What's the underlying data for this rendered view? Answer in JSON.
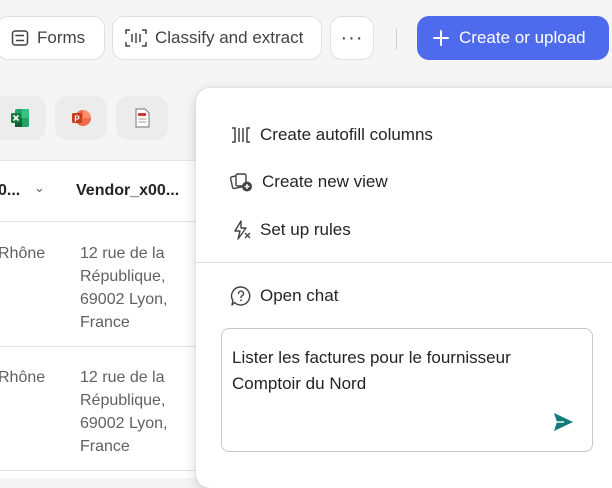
{
  "toolbar": {
    "forms_label": "Forms",
    "classify_label": "Classify and extract",
    "more_label": "···",
    "create_label": "Create or upload"
  },
  "file_chips": [
    {
      "icon": "excel-icon",
      "color": "#107c41"
    },
    {
      "icon": "powerpoint-icon",
      "color": "#c43e1c"
    },
    {
      "icon": "pdf-icon",
      "color": "#d13438"
    }
  ],
  "table": {
    "columns": [
      {
        "label": "0..."
      },
      {
        "label": "Vendor_x00..."
      }
    ],
    "rows": [
      {
        "city": "Rhône",
        "address": "12 rue de la République, 69002 Lyon, France"
      },
      {
        "city": "Rhône",
        "address": "12 rue de la République, 69002 Lyon, France"
      }
    ]
  },
  "menu": {
    "items": [
      {
        "label": "Create autofill columns",
        "icon": "autofill-columns-icon"
      },
      {
        "label": "Create new view",
        "icon": "new-view-icon"
      },
      {
        "label": "Set up rules",
        "icon": "rules-icon"
      }
    ],
    "chat_label": "Open chat",
    "chat_text": "Lister les factures pour le fournisseur Comptoir du Nord"
  },
  "colors": {
    "accent": "#4f6bed",
    "send": "#0f7b7b"
  }
}
